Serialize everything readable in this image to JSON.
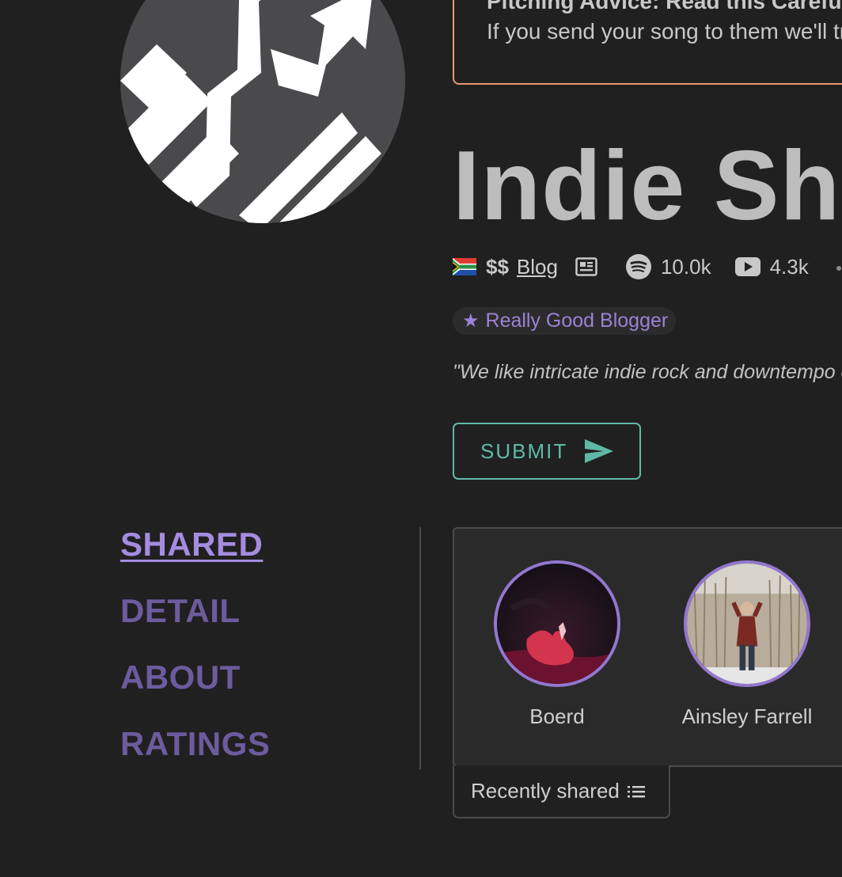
{
  "notice": {
    "title": "Pitching Advice: Read this Carefully",
    "text": "If you send your song to them we'll track your placement"
  },
  "curator": {
    "name": "Indie Shuffle",
    "price": "$$",
    "type_label": "Blog",
    "spotify_followers": "10.0k",
    "youtube_subscribers": "4.3k",
    "badge": "Really Good Blogger",
    "quote": "\"We like intricate indie rock and downtempo electronica",
    "submit_label": "SUBMIT"
  },
  "icons": {
    "flag": "south-africa-flag",
    "type": "newspaper-icon",
    "spotify": "spotify-icon",
    "youtube": "youtube-icon",
    "badge": "star-icon",
    "submit": "send-icon",
    "sort": "list-icon"
  },
  "nav": {
    "items": [
      {
        "label": "SHARED",
        "active": true
      },
      {
        "label": "DETAIL",
        "active": false
      },
      {
        "label": "ABOUT",
        "active": false
      },
      {
        "label": "RATINGS",
        "active": false
      }
    ]
  },
  "shared": {
    "artists": [
      {
        "name": "Boerd"
      },
      {
        "name": "Ainsley Farrell"
      }
    ],
    "sort_label": "Recently shared"
  },
  "colors": {
    "accent_purple": "#a48ce0",
    "nav_purple": "#6c5b9d",
    "submit_teal": "#5fb9a6",
    "notice_orange": "#e89a6c",
    "background": "#202020"
  }
}
